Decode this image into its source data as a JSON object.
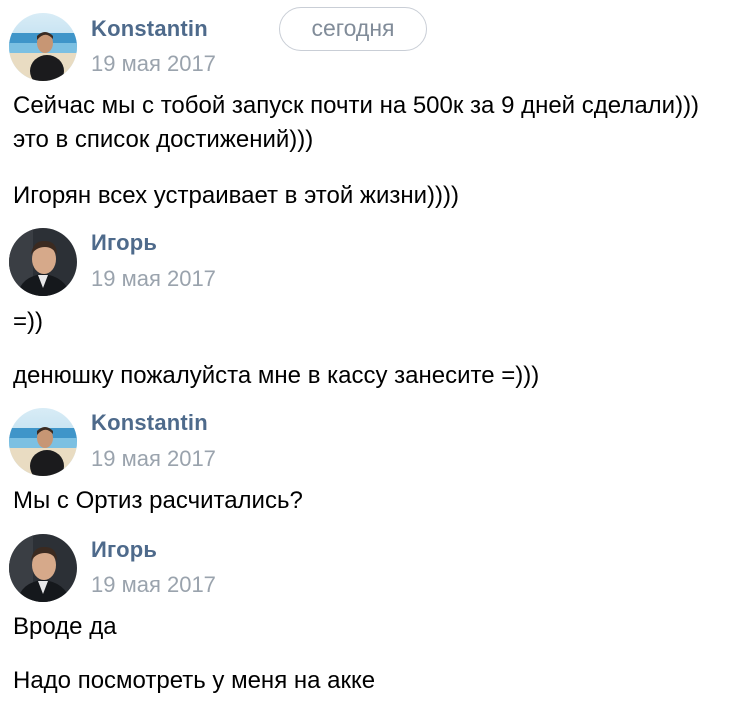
{
  "date_divider": "сегодня",
  "messages": [
    {
      "author": "Konstantin",
      "time": "19 мая 2017",
      "avatar": "avatar-konstantin-beach",
      "lines": [
        "Сейчас мы с тобой запуск почти на 500к за 9 дней сделали))) это в список достижений)))",
        "Игорян всех устраивает в этой жизни))))"
      ]
    },
    {
      "author": "Игорь",
      "time": "19 мая 2017",
      "avatar": "avatar-igor-portrait",
      "lines": [
        "=))",
        "денюшку пожалуйста мне в кассу занесите =)))"
      ]
    },
    {
      "author": "Konstantin",
      "time": "19 мая 2017",
      "avatar": "avatar-konstantin-beach",
      "lines": [
        "Мы с Ортиз расчитались?"
      ]
    },
    {
      "author": "Игорь",
      "time": "19 мая 2017",
      "avatar": "avatar-igor-portrait",
      "lines": [
        "Вроде да",
        "Надо посмотреть у меня на акке"
      ]
    }
  ],
  "colors": {
    "author_name": "#4e6a8b",
    "timestamp": "#9aa3ad",
    "message_text": "#000000",
    "pill_border": "#c9ced6",
    "pill_text": "#818c99"
  }
}
